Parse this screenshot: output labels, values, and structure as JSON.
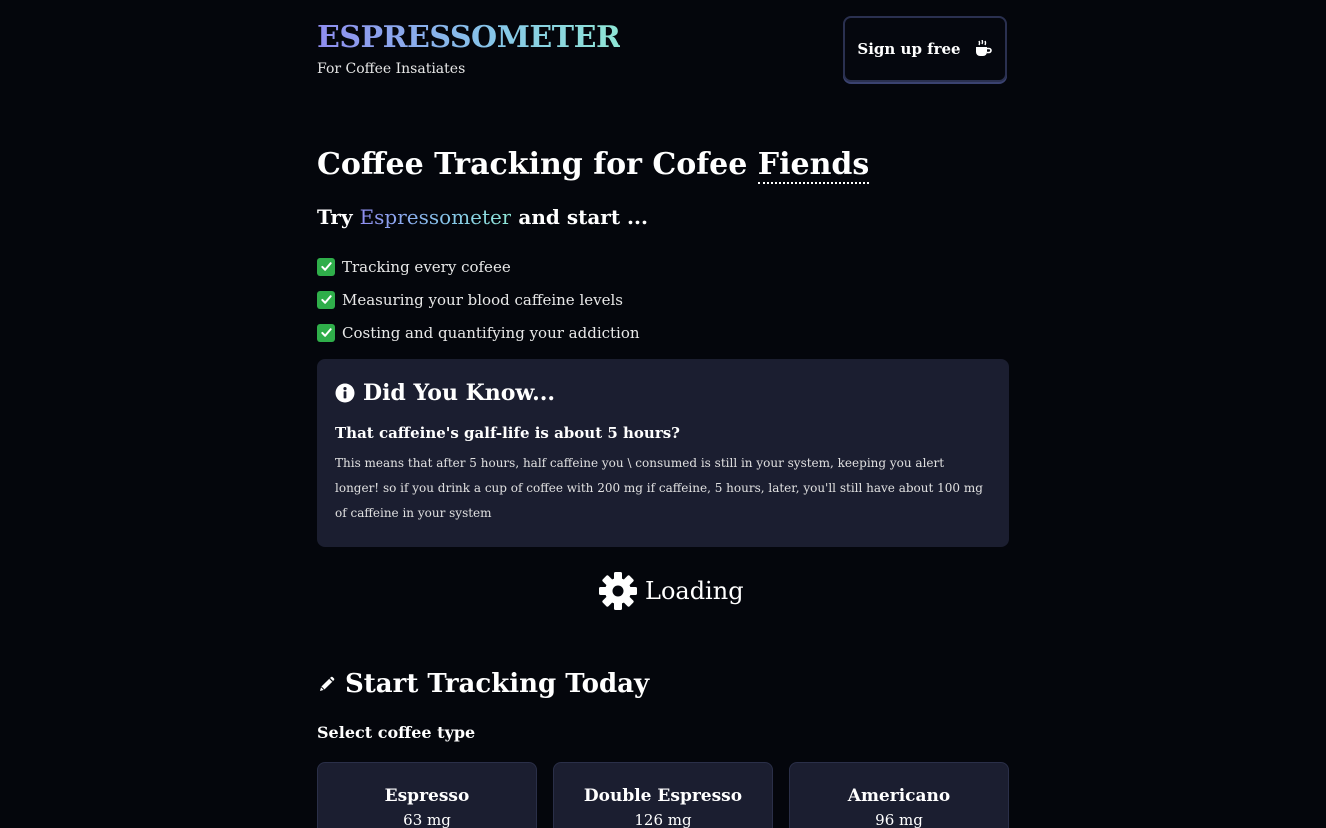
{
  "header": {
    "logo_text": "ESPRESSOMETER",
    "tagline": "For Coffee Insatiates",
    "signup_label": "Sign up free"
  },
  "hero": {
    "title_main": "Coffee Tracking for Cofee ",
    "title_underlined": "Fiends",
    "try_prefix": "Try ",
    "try_brand": "Espressometer",
    "try_suffix": " and start ..."
  },
  "features": [
    "Tracking every cofeee",
    "Measuring your blood caffeine levels",
    "Costing and quantifying your addiction"
  ],
  "did_you_know": {
    "heading": "Did You Know...",
    "question": "That caffeine's galf-life is about 5 hours?",
    "body": "This means that after 5 hours, half caffeine you \\ consumed is still in your system, keeping you alert longer! so if you drink a cup of coffee with 200 mg if caffeine, 5 hours, later, you'll still have about 100 mg of caffeine in your system"
  },
  "loading": {
    "label": "Loading"
  },
  "tracking": {
    "heading": "Start Tracking Today",
    "select_label": "Select coffee type",
    "coffee_types": [
      {
        "name": "Espresso",
        "caffeine": "63 mg"
      },
      {
        "name": "Double Espresso",
        "caffeine": "126 mg"
      },
      {
        "name": "Americano",
        "caffeine": "96 mg"
      }
    ]
  },
  "icons": {
    "signup": "coffee-cup-icon",
    "feature": "check-mark-icon",
    "did_you_know": "info-circle-icon",
    "loading": "gear-icon",
    "tracking": "pencil-icon"
  },
  "colors": {
    "background": "#04060c",
    "card": "#1b1e30",
    "brand_gradient_start": "#8f8df0",
    "brand_gradient_end": "#8fe6d6",
    "check_green": "#2fae4a"
  }
}
